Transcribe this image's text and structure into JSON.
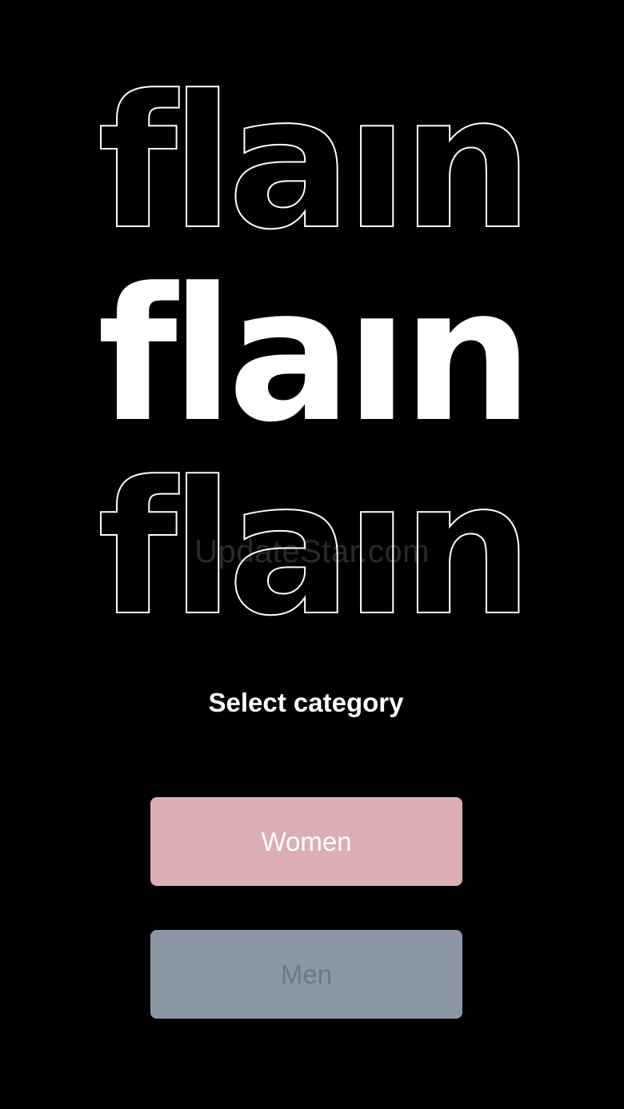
{
  "brand": {
    "logo_text": "flaın",
    "watermark": "UpdateStar.com"
  },
  "onboarding": {
    "title": "Select category",
    "options": [
      {
        "label": "Women",
        "background": "#ddadb4",
        "text_color": "#ffffff"
      },
      {
        "label": "Men",
        "background": "#8c97a6",
        "text_color": "#6e7887"
      }
    ]
  },
  "colors": {
    "background": "#000000",
    "logo_fill": "#ffffff",
    "logo_outline": "#ffffff"
  }
}
